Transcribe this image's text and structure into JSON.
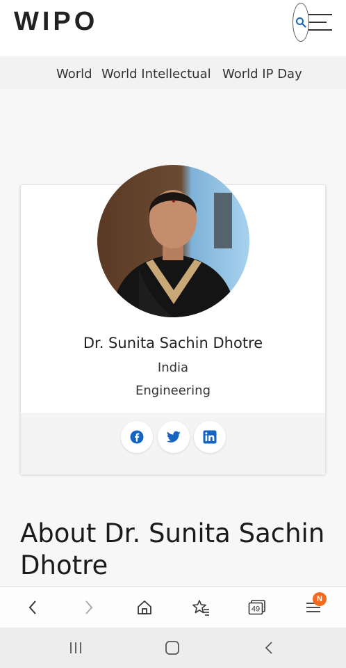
{
  "header": {
    "logo": "WIPO",
    "search_icon": "search-icon",
    "menu_icon": "hamburger-menu-icon"
  },
  "subnav": {
    "items": [
      "World",
      "World Intellectual",
      "World IP Day"
    ]
  },
  "profile": {
    "name": "Dr. Sunita Sachin Dhotre",
    "country": "India",
    "field": "Engineering",
    "photo_icon": "profile-photo",
    "social": [
      {
        "icon": "facebook-icon"
      },
      {
        "icon": "twitter-icon"
      },
      {
        "icon": "linkedin-icon"
      }
    ]
  },
  "about": {
    "title": "About Dr. Sunita Sachin Dhotre"
  },
  "browser": {
    "tab_count": "49",
    "menu_badge": "N",
    "icons": [
      "back-icon",
      "forward-icon",
      "home-icon",
      "bookmarks-icon",
      "tabs-icon",
      "menu-icon"
    ]
  },
  "system_nav": {
    "icons": [
      "recent-apps-icon",
      "home-icon",
      "back-icon"
    ]
  },
  "colors": {
    "accent": "#1565c0",
    "badge": "#f26b1f"
  }
}
